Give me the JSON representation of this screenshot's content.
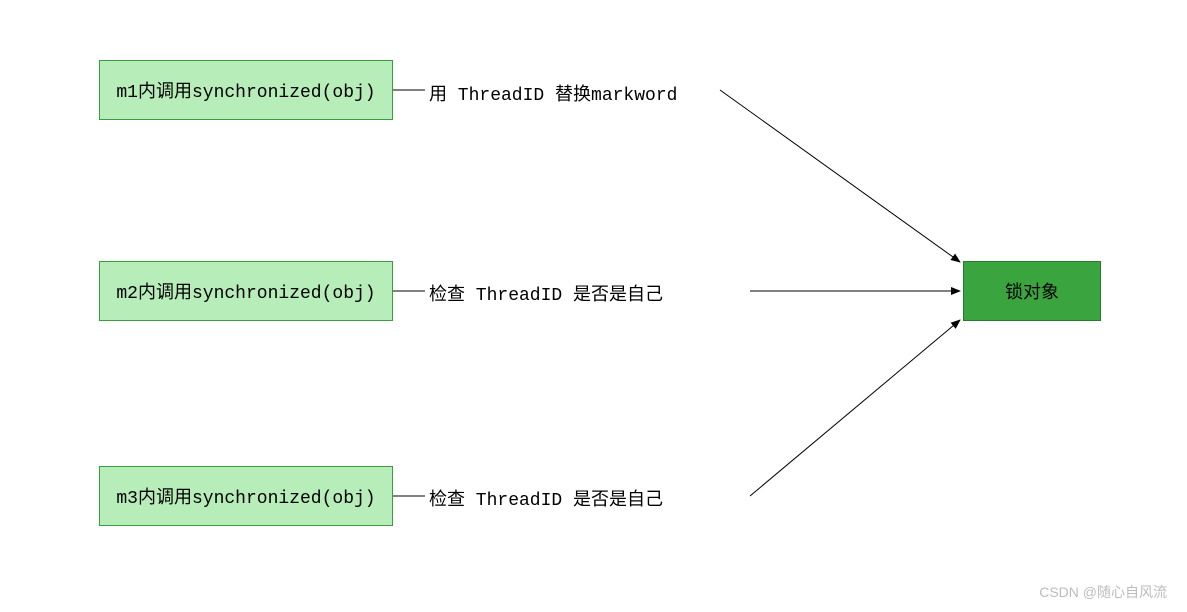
{
  "nodes": {
    "m1": "m1内调用synchronized(obj)",
    "m2": "m2内调用synchronized(obj)",
    "m3": "m3内调用synchronized(obj)",
    "lock": "锁对象"
  },
  "edges": {
    "e1_label": "用 ThreadID 替换markword",
    "e2_label": "检查 ThreadID 是否是自己",
    "e3_label": "检查 ThreadID 是否是自己"
  },
  "watermark": "CSDN @随心自风流",
  "colors": {
    "light_fill": "#b7edb8",
    "light_stroke": "#3a9e3e",
    "dark_fill": "#3aa43f",
    "dark_stroke": "#2a7a2e"
  }
}
